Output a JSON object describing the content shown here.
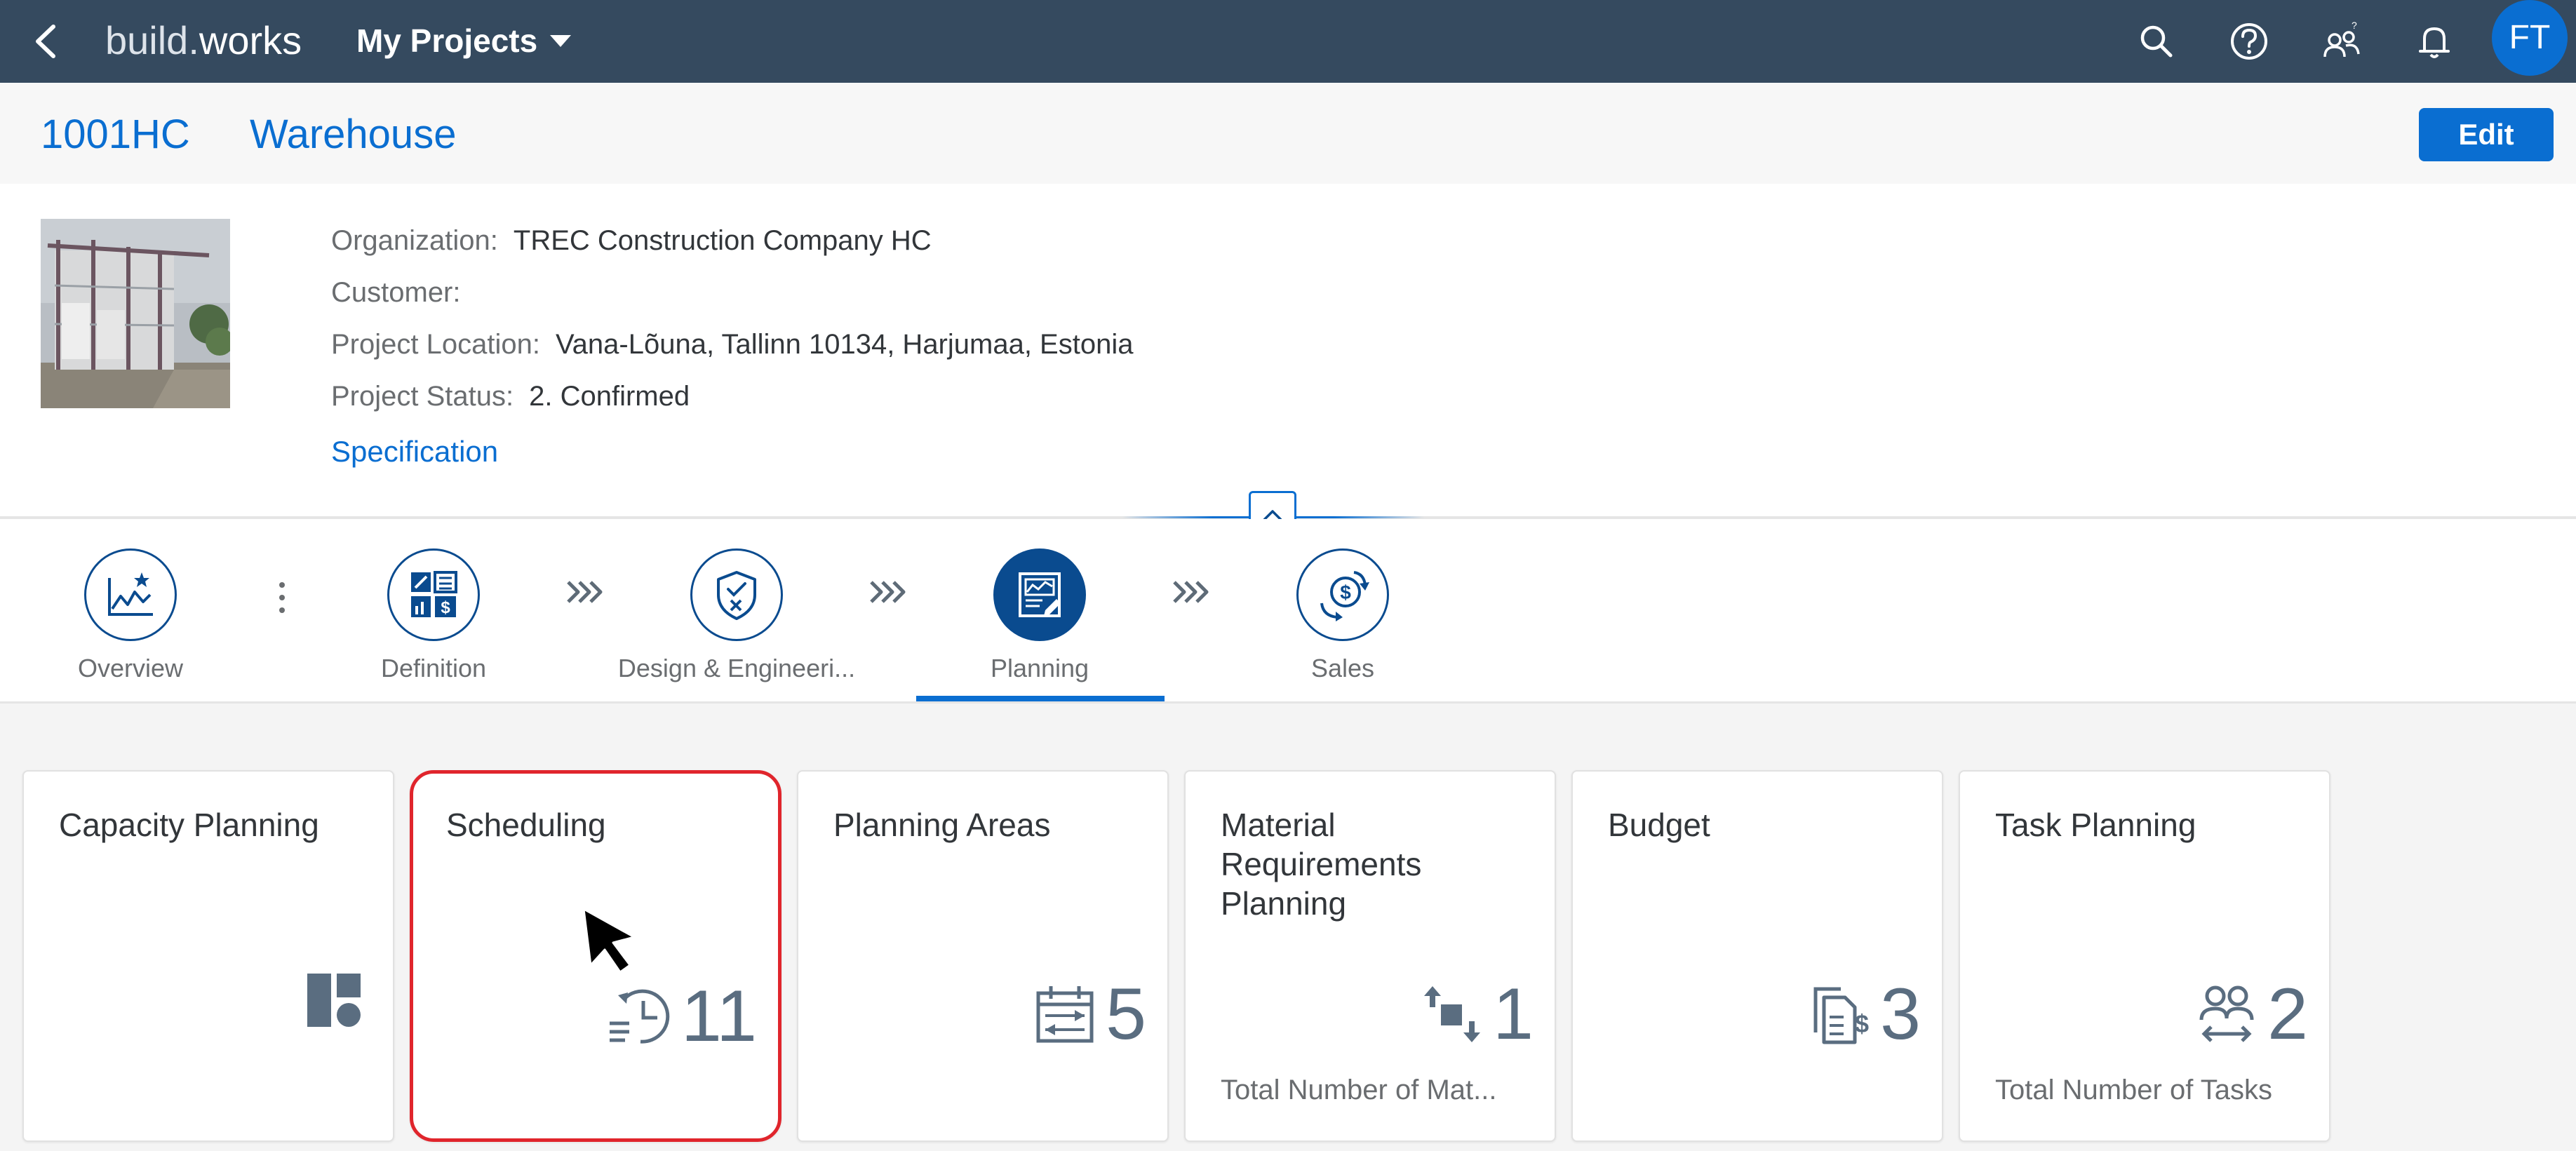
{
  "shell": {
    "brand_prefix": "build.",
    "brand_suffix": "works",
    "menu_label": "My Projects",
    "avatar_initials": "FT",
    "icons": [
      "back-icon",
      "search-icon",
      "help-icon",
      "people-icon",
      "notification-icon"
    ],
    "background": "#354a5f"
  },
  "header": {
    "project_id": "1001HC",
    "project_name": "Warehouse",
    "edit_label": "Edit",
    "attributes": [
      {
        "label": "Organization:",
        "value": "TREC Construction Company HC"
      },
      {
        "label": "Customer:",
        "value": ""
      },
      {
        "label": "Project Location:",
        "value": "Vana-Lõuna, Tallinn 10134, Harjumaa, Estonia"
      },
      {
        "label": "Project Status:",
        "value": "2. Confirmed"
      }
    ],
    "link_label": "Specification"
  },
  "process_flow": {
    "steps": [
      {
        "label": "Overview",
        "icon": "overview-chart-icon",
        "active": false
      },
      {
        "label": "Definition",
        "icon": "definition-icon",
        "active": false
      },
      {
        "label": "Design & Engineeri...",
        "icon": "design-shield-icon",
        "active": false
      },
      {
        "label": "Planning",
        "icon": "planning-icon",
        "active": true
      },
      {
        "label": "Sales",
        "icon": "sales-money-icon",
        "active": false
      }
    ]
  },
  "tiles": [
    {
      "title": "Capacity Planning",
      "icon": "capacity-icon",
      "value": "",
      "footer": ""
    },
    {
      "title": "Scheduling",
      "icon": "schedule-clock-icon",
      "value": "11",
      "footer": ""
    },
    {
      "title": "Planning Areas",
      "icon": "calendar-icon",
      "value": "5",
      "footer": ""
    },
    {
      "title": "Material Requirements Planning",
      "icon": "material-arrows-icon",
      "value": "1",
      "footer": "Total Number of Mat..."
    },
    {
      "title": "Budget",
      "icon": "budget-document-icon",
      "value": "3",
      "footer": ""
    },
    {
      "title": "Task Planning",
      "icon": "task-people-icon",
      "value": "2",
      "footer": "Total Number of Tasks"
    }
  ],
  "colors": {
    "accent": "#0a6ed1",
    "dark_accent": "#0a4b8f",
    "highlight": "#e0252c",
    "kpi": "#5a6d80"
  }
}
